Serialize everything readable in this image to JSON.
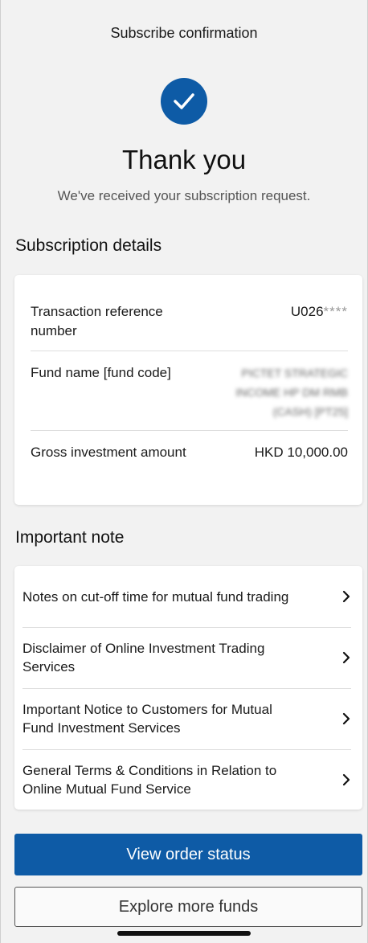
{
  "header": {
    "title": "Subscribe confirmation"
  },
  "confirmation": {
    "icon": "check-circle-icon",
    "heading": "Thank you",
    "message": "We've received your subscription request."
  },
  "details": {
    "section_title": "Subscription details",
    "rows": [
      {
        "label": "Transaction reference number",
        "value": "U026",
        "masked": "****"
      },
      {
        "label": "Fund name [fund code]",
        "value": "PICTET STRATEGIC INCOME HP DM RMB (CASH) [PT25]"
      },
      {
        "label": "Gross investment amount",
        "value": "HKD 10,000.00"
      }
    ]
  },
  "notes": {
    "section_title": "Important note",
    "items": [
      {
        "label": "Notes on cut-off time for mutual fund trading"
      },
      {
        "label": "Disclaimer of Online Investment Trading Services"
      },
      {
        "label": "Important Notice to Customers for Mutual Fund Investment Services"
      },
      {
        "label": "General Terms & Conditions in Relation to Online Mutual Fund Service"
      }
    ]
  },
  "actions": {
    "primary_label": "View order status",
    "secondary_label": "Explore more funds"
  },
  "colors": {
    "brand_blue": "#0e5ba6",
    "background": "#f2f2f2"
  }
}
